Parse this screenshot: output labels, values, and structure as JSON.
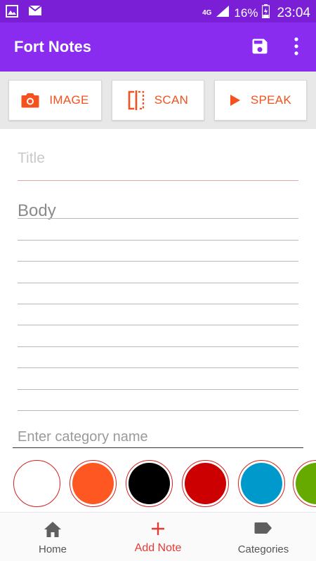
{
  "status_bar": {
    "network": "4G",
    "battery": "16%",
    "time": "23:04"
  },
  "app_bar": {
    "title": "Fort Notes",
    "save_icon": "save-icon",
    "more_icon": "more-vert-icon"
  },
  "toolbar": {
    "image_label": "IMAGE",
    "scan_label": "SCAN",
    "speak_label": "SPEAK",
    "accent": "#f4511e"
  },
  "note": {
    "title_placeholder": "Title",
    "body_placeholder": "Body",
    "category_placeholder": "Enter category name"
  },
  "colors": [
    "#ffffff",
    "#ff5722",
    "#000000",
    "#cc0000",
    "#0099cc",
    "#66aa00"
  ],
  "bottom_nav": {
    "home_label": "Home",
    "add_label": "Add Note",
    "categories_label": "Categories"
  }
}
